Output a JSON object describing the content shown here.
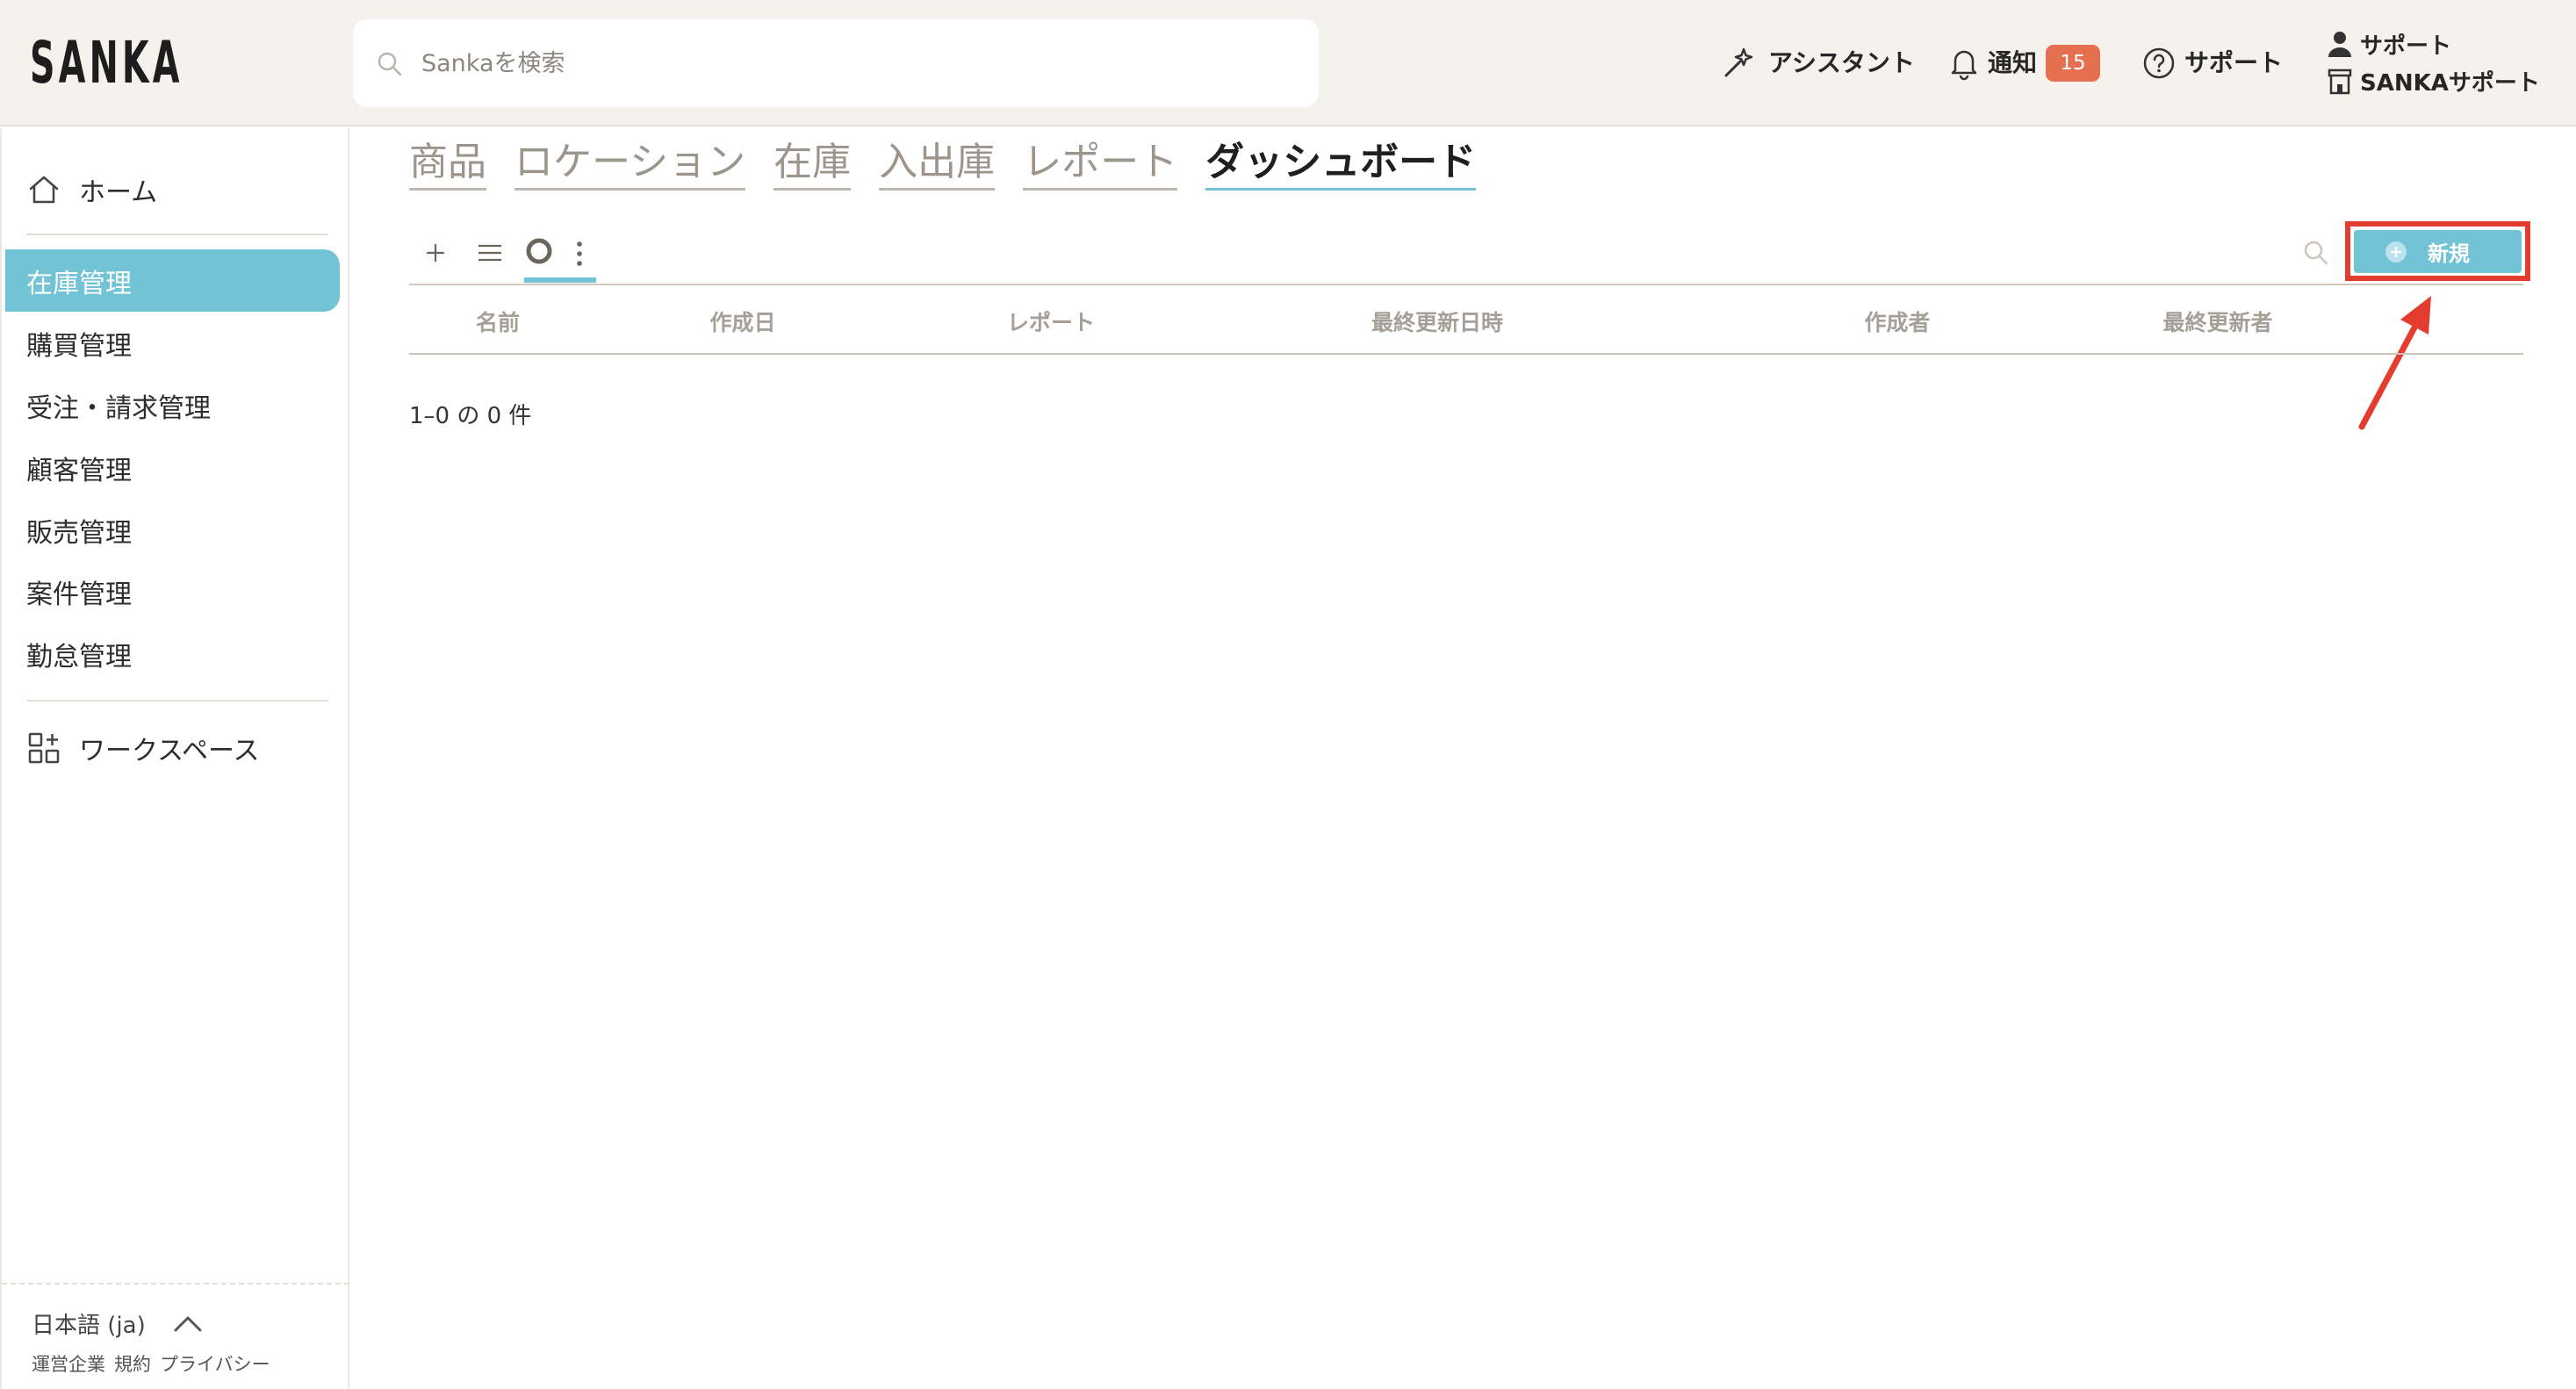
{
  "logo": "SANKA",
  "header": {
    "search": {
      "placeholder": "Sankaを検索",
      "icon": "search-icon"
    },
    "assistant": {
      "label": "アシスタント",
      "icon": "magic-wand-icon"
    },
    "notifications": {
      "label": "通知",
      "count": "15",
      "icon": "bell-icon"
    },
    "support": {
      "label": "サポート",
      "icon": "question-circle-icon"
    },
    "account": {
      "user": "サポート",
      "workspace": "SANKAサポート"
    }
  },
  "sidebar": {
    "home": "ホーム",
    "items": [
      {
        "label": "在庫管理",
        "active": true
      },
      {
        "label": "購買管理"
      },
      {
        "label": "受注・請求管理"
      },
      {
        "label": "顧客管理"
      },
      {
        "label": "販売管理"
      },
      {
        "label": "案件管理"
      },
      {
        "label": "勤怠管理"
      }
    ],
    "workspace": "ワークスペース",
    "language": "日本語 (ja)",
    "footer_links": [
      "運営企業",
      "規約",
      "プライバシー"
    ]
  },
  "main": {
    "tabs": [
      {
        "label": "商品"
      },
      {
        "label": "ロケーション"
      },
      {
        "label": "在庫"
      },
      {
        "label": "入出庫"
      },
      {
        "label": "レポート"
      },
      {
        "label": "ダッシュボード",
        "active": true
      }
    ],
    "new_button": "新規",
    "columns": [
      "名前",
      "作成日",
      "レポート",
      "最終更新日時",
      "作成者",
      "最終更新者"
    ],
    "pagination": "1–0 の 0 件"
  },
  "colors": {
    "accent": "#72c3d6",
    "header_bg": "#f5f1ec",
    "badge": "#e5704f",
    "annotation": "#e43d2f",
    "muted": "#a29b92"
  }
}
